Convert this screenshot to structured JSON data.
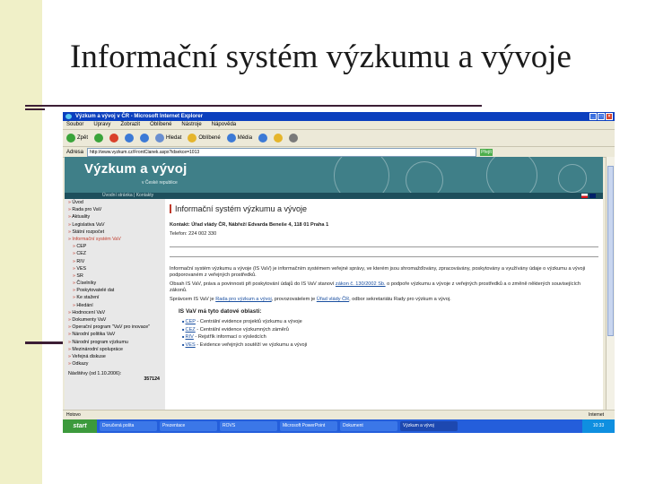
{
  "slide": {
    "title": "Informační systém výzkumu a vývoje",
    "stripe_color": "#f0f0c8",
    "rule_color": "#3c1e35"
  },
  "browser": {
    "window_title": "Výzkum a vývoj v ČR - Microsoft Internet Explorer",
    "menu": [
      "Soubor",
      "Úpravy",
      "Zobrazit",
      "Oblíbené",
      "Nástroje",
      "Nápověda"
    ],
    "toolbar": [
      {
        "label": "Zpět",
        "icon": "back-icon"
      },
      {
        "label": "",
        "icon": "forward-icon"
      },
      {
        "label": "",
        "icon": "stop-icon"
      },
      {
        "label": "",
        "icon": "refresh-icon"
      },
      {
        "label": "",
        "icon": "home-icon"
      },
      {
        "label": "Hledat",
        "icon": "search-icon"
      },
      {
        "label": "Oblíbené",
        "icon": "favorites-icon"
      },
      {
        "label": "Média",
        "icon": "media-icon"
      },
      {
        "label": "",
        "icon": "history-icon"
      },
      {
        "label": "",
        "icon": "mail-icon"
      },
      {
        "label": "",
        "icon": "print-icon"
      }
    ],
    "address_label": "Adresa",
    "address_value": "http://www.vyzkum.cz/FrontClanek.aspx?idsekce=1013",
    "go_label": "Přejít",
    "status_text": "Hotovo",
    "zone_text": "Internet"
  },
  "site": {
    "banner_title": "Výzkum a vývoj",
    "banner_subtitle": "v České republice",
    "subnav": "Úvodní stránka | Kontakty",
    "sidebar": [
      {
        "label": "Úvod",
        "sub": false,
        "active": false
      },
      {
        "label": "Rada pro VaV",
        "sub": false,
        "active": false
      },
      {
        "label": "Aktuality",
        "sub": false,
        "active": false
      },
      {
        "label": "Legislativa VaV",
        "sub": false,
        "active": false
      },
      {
        "label": "Státní rozpočet",
        "sub": false,
        "active": false
      },
      {
        "label": "Informační systém VaV",
        "sub": false,
        "active": true
      },
      {
        "label": "CEP",
        "sub": true,
        "active": false
      },
      {
        "label": "CEZ",
        "sub": true,
        "active": false
      },
      {
        "label": "RIV",
        "sub": true,
        "active": false
      },
      {
        "label": "VES",
        "sub": true,
        "active": false
      },
      {
        "label": "SR",
        "sub": true,
        "active": false
      },
      {
        "label": "Číselníky",
        "sub": true,
        "active": false
      },
      {
        "label": "Poskytovatelé dat",
        "sub": true,
        "active": false
      },
      {
        "label": "Ke stažení",
        "sub": true,
        "active": false
      },
      {
        "label": "Hledání",
        "sub": true,
        "active": false
      },
      {
        "label": "Hodnocení VaV",
        "sub": false,
        "active": false
      },
      {
        "label": "Dokumenty VaV",
        "sub": false,
        "active": false
      },
      {
        "label": "Operační program \"VaV pro inovace\"",
        "sub": false,
        "active": false
      },
      {
        "label": "Národní politika VaV",
        "sub": false,
        "active": false
      },
      {
        "label": "Národní program výzkumu",
        "sub": false,
        "active": false
      },
      {
        "label": "Mezinárodní spolupráce",
        "sub": false,
        "active": false
      },
      {
        "label": "Veřejná diskuse",
        "sub": false,
        "active": false
      },
      {
        "label": "Odkazy",
        "sub": false,
        "active": false
      }
    ],
    "visits_label": "Návštěvy (od 1.10.2006):",
    "visits_count": "357124",
    "page_heading": "Informační systém výzkumu a vývoje",
    "contact_line": "Kontakt: Úřad vlády ČR, Nábřeží Edvarda Beneše 4, 118 01 Praha 1",
    "phone_line": "Telefon: 224 002 330",
    "para1_a": "Informační systém výzkumu a vývoje (IS VaV) je informačním systémem veřejné správy, ve kterém jsou shromažďovány, zpracovávány, poskytovány a využívány údaje o výzkumu a vývoji podporovaném z veřejných prostředků.",
    "para2_a": "Obsah IS VaV, práva a povinnosti při poskytování údajů do IS VaV stanoví",
    "para2_link": "zákon č. 130/2002 Sb.",
    "para2_b": "o podpoře výzkumu a vývoje z veřejných prostředků a o změně některých souvisejících zákonů.",
    "para3_a": "Správcem IS VaV je",
    "para3_link1": "Rada pro výzkum a vývoj",
    "para3_b": ", provozovatelem je",
    "para3_link2": "Úřad vlády ČR",
    "para3_c": ", odbor sekretariátu Rady pro výzkum a vývoj.",
    "data_heading": "IS VaV má tyto datové oblasti:",
    "data_items": [
      {
        "code": "CEP",
        "text": "- Centrální evidence projektů výzkumu a vývoje"
      },
      {
        "code": "CEZ",
        "text": "- Centrální evidence výzkumných záměrů"
      },
      {
        "code": "RIV",
        "text": "- Rejstřík informací o výsledcích"
      },
      {
        "code": "VES",
        "text": "- Evidence veřejných soutěží ve výzkumu a vývoji"
      }
    ]
  },
  "taskbar": {
    "start_label": "start",
    "items": [
      {
        "label": "Doručená pošta",
        "active": false
      },
      {
        "label": "Prezentace",
        "active": false
      },
      {
        "label": "ROVS",
        "active": false
      },
      {
        "label": "Microsoft PowerPoint",
        "active": false
      },
      {
        "label": "Dokument",
        "active": false
      },
      {
        "label": "Výzkum a vývoj",
        "active": true
      }
    ],
    "clock": "10:33"
  }
}
